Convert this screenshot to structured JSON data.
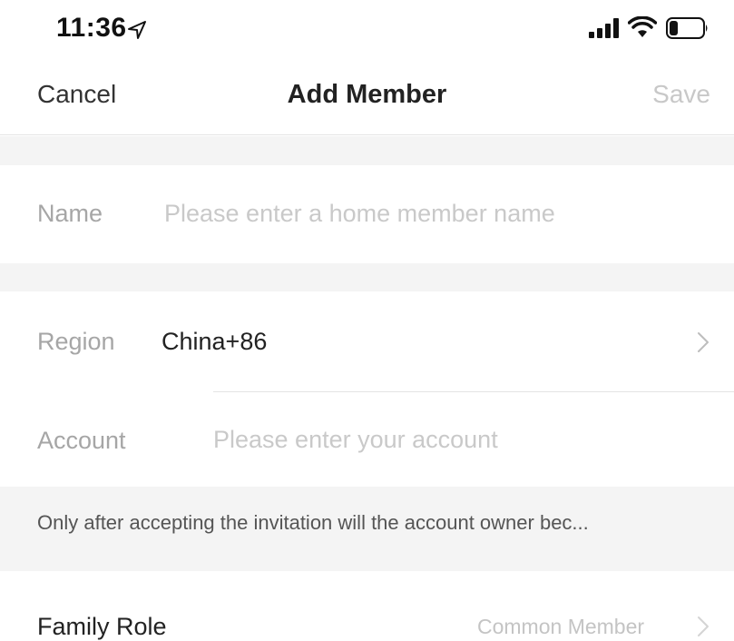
{
  "status_bar": {
    "time": "11:36",
    "location_icon": "location-arrow-icon",
    "signal_icon": "signal-bars-icon",
    "wifi_icon": "wifi-icon",
    "battery_icon": "battery-icon"
  },
  "nav": {
    "cancel_label": "Cancel",
    "title": "Add Member",
    "save_label": "Save"
  },
  "form": {
    "name": {
      "label": "Name",
      "placeholder": "Please enter a home member name"
    },
    "region": {
      "label": "Region",
      "value": "China+86"
    },
    "account": {
      "label": "Account",
      "placeholder": "Please enter your account"
    },
    "notice": "Only after accepting the invitation will the account owner bec...",
    "family_role": {
      "label": "Family Role",
      "value": "Common Member"
    }
  },
  "colors": {
    "background": "#ffffff",
    "section_gap": "#f4f4f4",
    "label_muted": "#a6a6a6",
    "placeholder": "#c9c9c9",
    "save_disabled": "#c8c8c8",
    "text_primary": "#222222"
  }
}
